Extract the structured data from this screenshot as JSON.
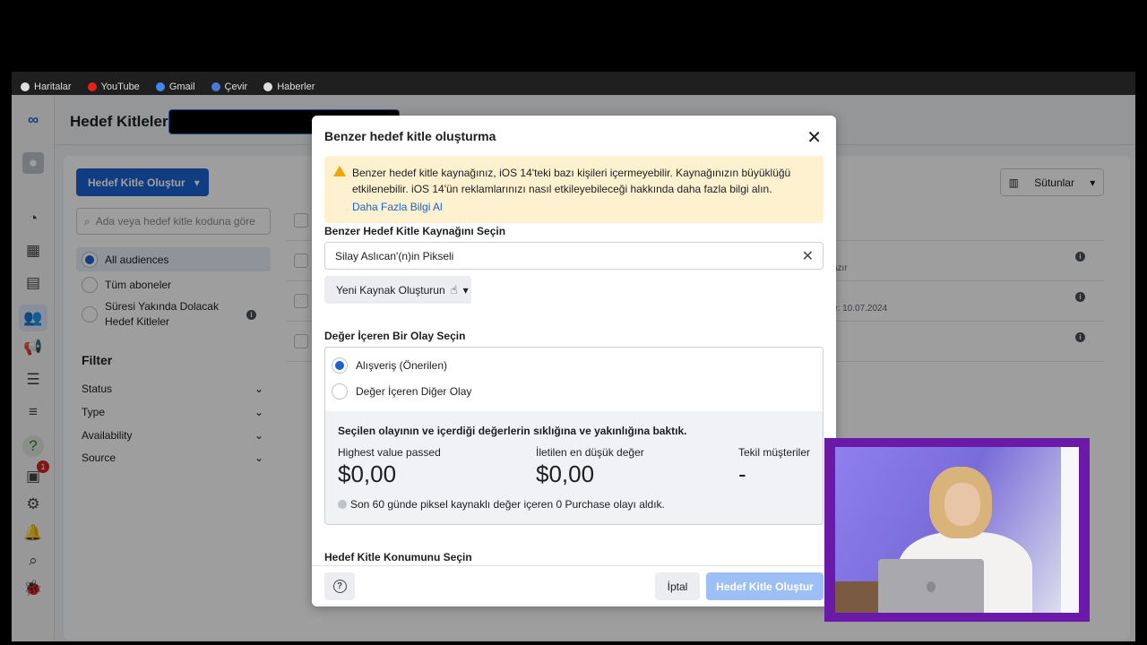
{
  "bookmarks": [
    "Haritalar",
    "YouTube",
    "Gmail",
    "Çevir",
    "Haberler"
  ],
  "header": {
    "title": "Hedef Kitleler"
  },
  "sidebar": {
    "create_label": "Hedef Kitle Oluştur",
    "search_placeholder": "Ada veya hedef kitle koduna göre",
    "audiences": [
      "All audiences",
      "Tüm aboneler",
      "Süresi Yakında Dolacak Hedef Kitleler"
    ],
    "filter_title": "Filter",
    "filters": [
      "Status",
      "Type",
      "Availability",
      "Source"
    ]
  },
  "toolbar": {
    "columns_label": "Sütunlar"
  },
  "table": {
    "fragments": [
      "azır",
      "e: 10.07.2024"
    ]
  },
  "modal": {
    "title": "Benzer hedef kitle oluşturma",
    "warning_text": "Benzer hedef kitle kaynağınız, iOS 14'teki bazı kişileri içermeyebilir. Kaynağınızın büyüklüğü etkilenebilir. iOS 14'ün reklamlarınızı nasıl etkileyebileceği hakkında daha fazla bilgi alın.",
    "warning_link": "Daha Fazla Bilgi Al",
    "source_heading": "Benzer Hedef Kitle Kaynağını Seçin",
    "source_value": "Silay Aslıcan'(n)in Pikseli",
    "new_source_label": "Yeni Kaynak Oluşturun",
    "event_heading": "Değer İçeren Bir Olay Seçin",
    "event_options": [
      "Alışveriş (Önerilen)",
      "Değer İçeren Diğer Olay"
    ],
    "stats_heading": "Seçilen olayının ve içerdiği değerlerin sıklığına ve yakınlığına baktık.",
    "stats": [
      {
        "label": "Highest value passed",
        "value": "$0,00"
      },
      {
        "label": "İletilen en düşük değer",
        "value": "$0,00"
      },
      {
        "label": "Tekil müşteriler",
        "value": "-"
      }
    ],
    "stats_note": "Son 60 günde piksel kaynaklı değer içeren 0 Purchase olayı aldık.",
    "location_heading": "Hedef Kitle Konumunu Seçin",
    "cancel_label": "İptal",
    "submit_label": "Hedef Kitle Oluştur"
  },
  "icons": {
    "rail": [
      "meta-logo-icon",
      "profile-icon",
      "dashboard-icon",
      "table-icon",
      "pages-icon",
      "audiences-icon",
      "megaphone-icon",
      "billing-icon",
      "menu-icon",
      "help-icon",
      "notifications-inbox-icon",
      "settings-icon",
      "bell-icon",
      "search-icon",
      "bug-icon"
    ],
    "rail_badge": "1"
  },
  "colors": {
    "primary": "#1b63d0",
    "warning_bg": "#fdf1cf",
    "webcam_border": "#6a19a8"
  }
}
